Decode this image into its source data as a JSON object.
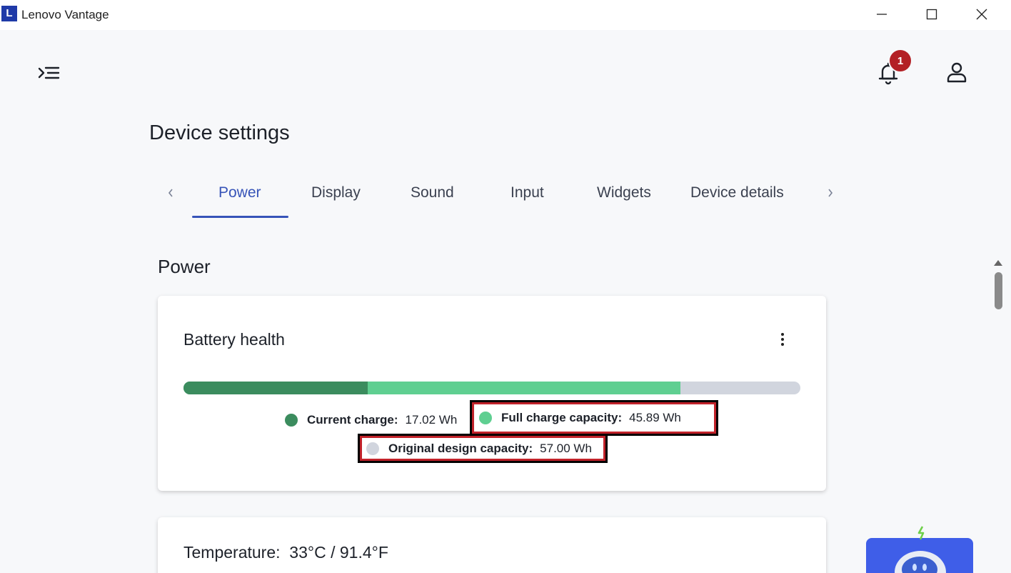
{
  "window": {
    "logo_letter": "L",
    "title": "Lenovo Vantage"
  },
  "header": {
    "notification_count": "1"
  },
  "page": {
    "title": "Device settings"
  },
  "tabs": [
    {
      "label": "Power",
      "active": true
    },
    {
      "label": "Display",
      "active": false
    },
    {
      "label": "Sound",
      "active": false
    },
    {
      "label": "Input",
      "active": false
    },
    {
      "label": "Widgets",
      "active": false
    },
    {
      "label": "Device details",
      "active": false
    }
  ],
  "section": {
    "title": "Power"
  },
  "battery": {
    "title": "Battery health",
    "current_charge_wh": 17.02,
    "full_charge_wh": 45.89,
    "design_capacity_wh": 57.0,
    "legend": {
      "current_label": "Current charge:",
      "current_value": "17.02 Wh",
      "full_label": "Full charge capacity:",
      "full_value": "45.89 Wh",
      "original_label": "Original design capacity:",
      "original_value": "57.00 Wh"
    },
    "colors": {
      "current": "#3b8c5e",
      "full": "#5fcf91",
      "original": "#d1d5de"
    }
  },
  "temperature": {
    "label": "Temperature:",
    "value": "33°C / 91.4°F"
  },
  "colors": {
    "accent": "#3754b8",
    "highlight_border": "#c1222a",
    "badge": "#b32025"
  }
}
